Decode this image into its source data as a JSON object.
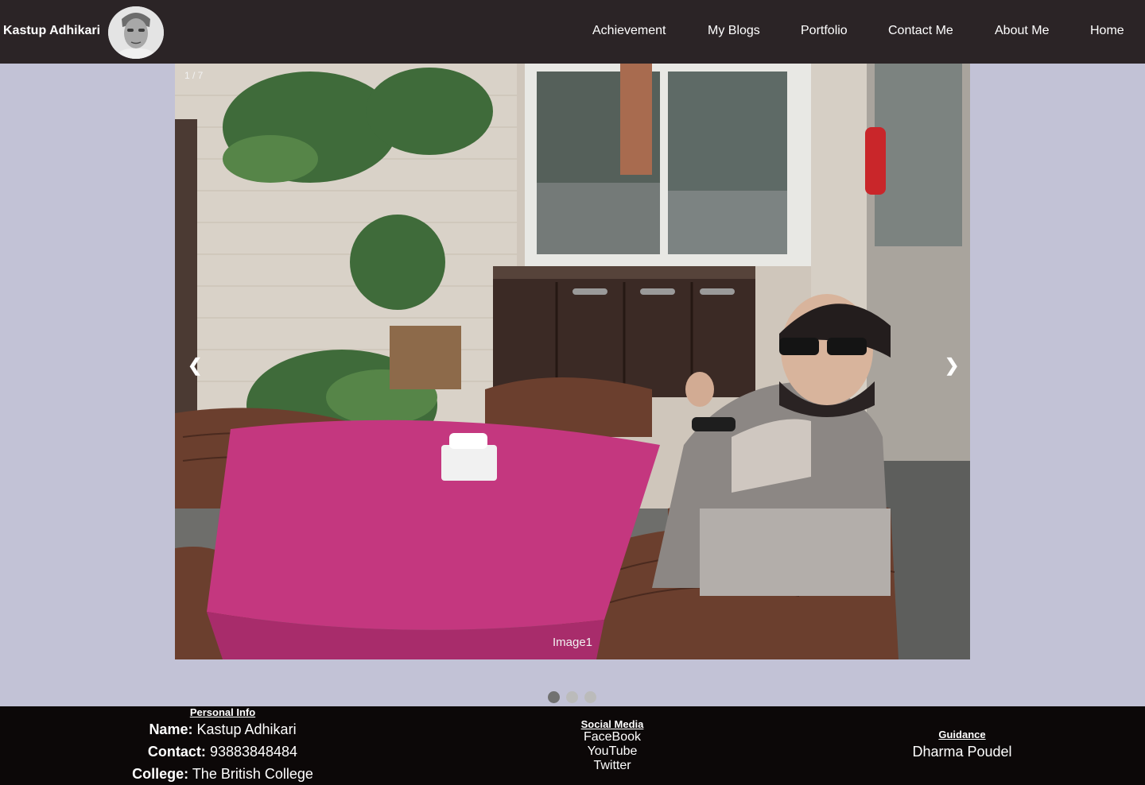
{
  "header": {
    "brand_name": "Kastup Adhikari",
    "nav_links": [
      "Achievement",
      "My Blogs",
      "Portfolio",
      "Contact Me",
      "About Me",
      "Home"
    ]
  },
  "slideshow": {
    "counter": "1 / 7",
    "prev_arrow": "❮",
    "next_arrow": "❯",
    "caption": "Image1",
    "active_dot": 0,
    "dot_count": 3
  },
  "footer": {
    "personal_info": {
      "heading": "Personal Info",
      "name_label": "Name:",
      "name_value": "Kastup Adhikari",
      "contact_label": "Contact:",
      "contact_value": "93883848484",
      "college_label": "College:",
      "college_value": "The British College"
    },
    "social_media": {
      "heading": "Social Media",
      "links": [
        "FaceBook",
        "YouTube",
        "Twitter"
      ]
    },
    "guidance": {
      "heading": "Guidance",
      "name": "Dharma Poudel"
    }
  },
  "colors": {
    "navbar_bg": "#2b2426",
    "page_bg": "#c2c2d6",
    "footer_bg": "#0c0808",
    "table_cloth": "#c4377f",
    "dot_active": "#717171",
    "dot_inactive": "#bbbbbb"
  }
}
